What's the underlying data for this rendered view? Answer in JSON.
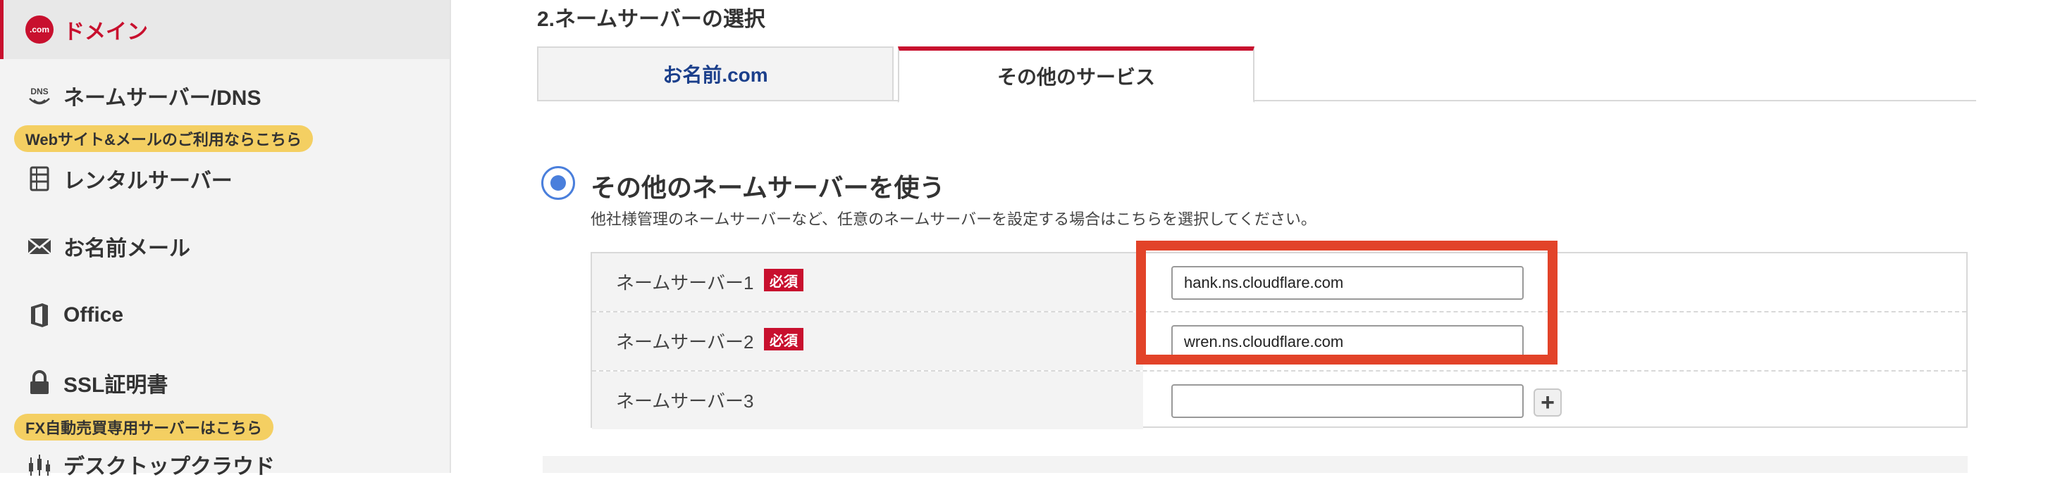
{
  "sidebar": {
    "items": [
      {
        "label": "ドメイン",
        "icon": "dotcom-icon"
      },
      {
        "label": "ネームサーバー/DNS",
        "icon": "dns-icon"
      },
      {
        "label": "レンタルサーバー",
        "icon": "server-icon"
      },
      {
        "label": "お名前メール",
        "icon": "mail-icon"
      },
      {
        "label": "Office",
        "icon": "office-icon"
      },
      {
        "label": "SSL証明書",
        "icon": "lock-icon"
      },
      {
        "label": "デスクトップクラウド",
        "icon": "chart-icon"
      }
    ],
    "badges": {
      "web_mail": "Webサイト&メールのご利用ならこちら",
      "fx": "FX自動売買専用サーバーはこちら"
    },
    "com_logo_text": ".com"
  },
  "main": {
    "section_title": "2.ネームサーバーの選択",
    "tabs": [
      {
        "label": "お名前.com"
      },
      {
        "label": "その他のサービス"
      }
    ],
    "option": {
      "title": "その他のネームサーバーを使う",
      "description": "他社様管理のネームサーバーなど、任意のネームサーバーを設定する場合はこちらを選択してください。"
    },
    "nameservers": [
      {
        "label": "ネームサーバー1",
        "required": "必須",
        "value": "hank.ns.cloudflare.com"
      },
      {
        "label": "ネームサーバー2",
        "required": "必須",
        "value": "wren.ns.cloudflare.com"
      },
      {
        "label": "ネームサーバー3",
        "value": ""
      }
    ],
    "add_button": "+"
  },
  "colors": {
    "brand_red": "#c8102e",
    "highlight": "#e24329",
    "radio_blue": "#4a7fdc",
    "badge_yellow": "#f4cf62"
  }
}
